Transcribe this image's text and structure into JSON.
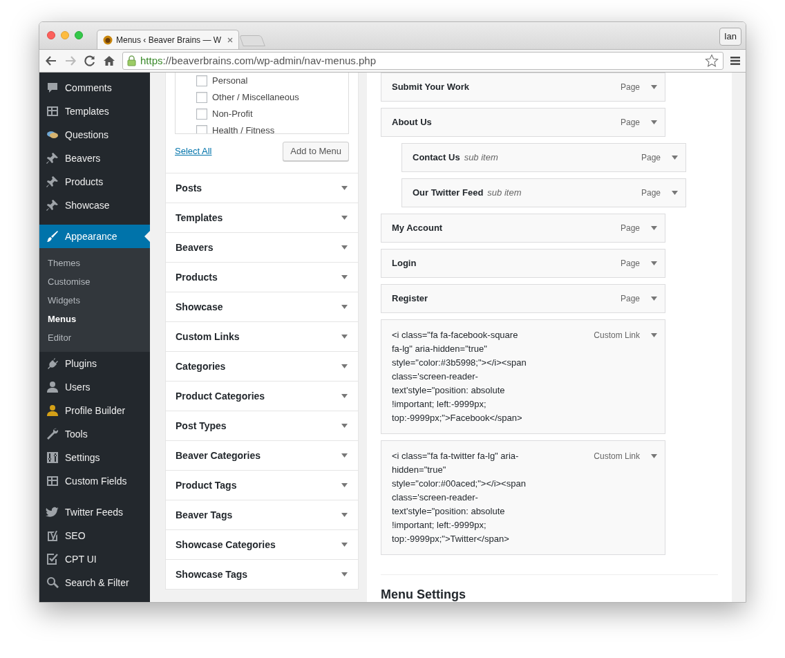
{
  "browser": {
    "tab_title": "Menus ‹ Beaver Brains — W",
    "profile": "Ian",
    "url_scheme": "https",
    "url_rest": "://beaverbrains.com/wp-admin/nav-menus.php"
  },
  "sidebar": {
    "groups": [
      [
        {
          "label": "Comments",
          "selected": false
        },
        {
          "label": "Templates",
          "selected": false
        },
        {
          "label": "Questions",
          "selected": false
        },
        {
          "label": "Beavers",
          "selected": false
        },
        {
          "label": "Products",
          "selected": false
        },
        {
          "label": "Showcase",
          "selected": false
        }
      ],
      [
        {
          "label": "Appearance",
          "selected": true,
          "children": [
            {
              "label": "Themes",
              "selected": false
            },
            {
              "label": "Customise",
              "selected": false
            },
            {
              "label": "Widgets",
              "selected": false
            },
            {
              "label": "Menus",
              "selected": true
            },
            {
              "label": "Editor",
              "selected": false
            }
          ]
        },
        {
          "label": "Plugins",
          "selected": false
        },
        {
          "label": "Users",
          "selected": false
        },
        {
          "label": "Profile Builder",
          "selected": false
        },
        {
          "label": "Tools",
          "selected": false
        },
        {
          "label": "Settings",
          "selected": false
        },
        {
          "label": "Custom Fields",
          "selected": false
        }
      ],
      [
        {
          "label": "Twitter Feeds",
          "selected": false
        },
        {
          "label": "SEO",
          "selected": false
        },
        {
          "label": "CPT UI",
          "selected": false
        },
        {
          "label": "Search & Filter",
          "selected": false
        }
      ]
    ]
  },
  "checklist": {
    "items": [
      {
        "label": "Personal",
        "checked": false
      },
      {
        "label": "Other / Miscellaneous",
        "checked": false
      },
      {
        "label": "Non-Profit",
        "checked": false
      },
      {
        "label": "Health / Fitness",
        "checked": false
      }
    ],
    "select_all": "Select All",
    "add_button": "Add to Menu"
  },
  "sections": [
    {
      "label": "Posts"
    },
    {
      "label": "Templates"
    },
    {
      "label": "Beavers"
    },
    {
      "label": "Products"
    },
    {
      "label": "Showcase"
    },
    {
      "label": "Custom Links"
    },
    {
      "label": "Categories"
    },
    {
      "label": "Product Categories"
    },
    {
      "label": "Post Types"
    },
    {
      "label": "Beaver Categories"
    },
    {
      "label": "Product Tags"
    },
    {
      "label": "Beaver Tags"
    },
    {
      "label": "Showcase Categories"
    },
    {
      "label": "Showcase Tags"
    }
  ],
  "menu_items": [
    {
      "kind": "page",
      "title": "Submit Your Work",
      "type_label": "Page"
    },
    {
      "kind": "page",
      "title": "About Us",
      "type_label": "Page",
      "children": [
        {
          "kind": "page",
          "title": "Contact Us",
          "note": "sub item",
          "type_label": "Page"
        },
        {
          "kind": "page",
          "title": "Our Twitter Feed",
          "note": "sub item",
          "type_label": "Page"
        }
      ]
    },
    {
      "kind": "page",
      "title": "My Account",
      "type_label": "Page"
    },
    {
      "kind": "page",
      "title": "Login",
      "type_label": "Page"
    },
    {
      "kind": "page",
      "title": "Register",
      "type_label": "Page"
    },
    {
      "kind": "custom",
      "title": "<i class=\"fa fa-facebook-square fa-lg\" aria-hidden=\"true\" style=\"color:#3b5998;\"></i><span class='screen-reader-text'style=\"position: absolute !important; left:-9999px; top:-9999px;\">Facebook</span>",
      "type_label": "Custom Link"
    },
    {
      "kind": "custom",
      "title": "<i class=\"fa fa-twitter fa-lg\" aria-hidden=\"true\" style=\"color:#00aced;\"></i><span class='screen-reader-text'style=\"position: absolute !important; left:-9999px; top:-9999px;\">Twitter</span>",
      "type_label": "Custom Link"
    }
  ],
  "menu_settings": {
    "heading": "Menu Settings"
  }
}
